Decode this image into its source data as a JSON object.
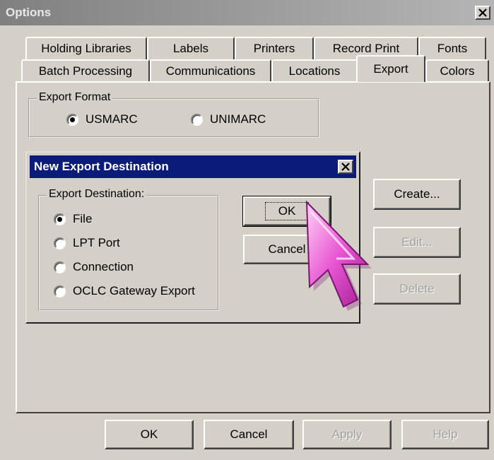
{
  "window": {
    "title": "Options"
  },
  "tabs": {
    "row_back": [
      "Holding Libraries",
      "Labels",
      "Printers",
      "Record Print",
      "Fonts"
    ],
    "row_front": [
      "Batch Processing",
      "Communications",
      "Locations",
      "Export",
      "Colors"
    ],
    "active": "Export"
  },
  "export_format": {
    "label": "Export Format",
    "options": [
      {
        "label": "USMARC",
        "selected": true
      },
      {
        "label": "UNIMARC",
        "selected": false
      }
    ]
  },
  "side_buttons": {
    "create": "Create...",
    "edit": "Edit...",
    "delete": "Delete"
  },
  "dialog": {
    "title": "New Export Destination",
    "group_label": "Export Destination:",
    "options": [
      {
        "label": "File",
        "selected": true
      },
      {
        "label": "LPT Port",
        "selected": false
      },
      {
        "label": "Connection",
        "selected": false
      },
      {
        "label": "OCLC Gateway Export",
        "selected": false
      }
    ],
    "ok": "OK",
    "cancel": "Cancel"
  },
  "footer": {
    "ok": "OK",
    "cancel": "Cancel",
    "apply": "Apply",
    "help": "Help"
  },
  "colors": {
    "dialog_titlebar": "#0a1b7a",
    "cursor": "#e040c8"
  }
}
